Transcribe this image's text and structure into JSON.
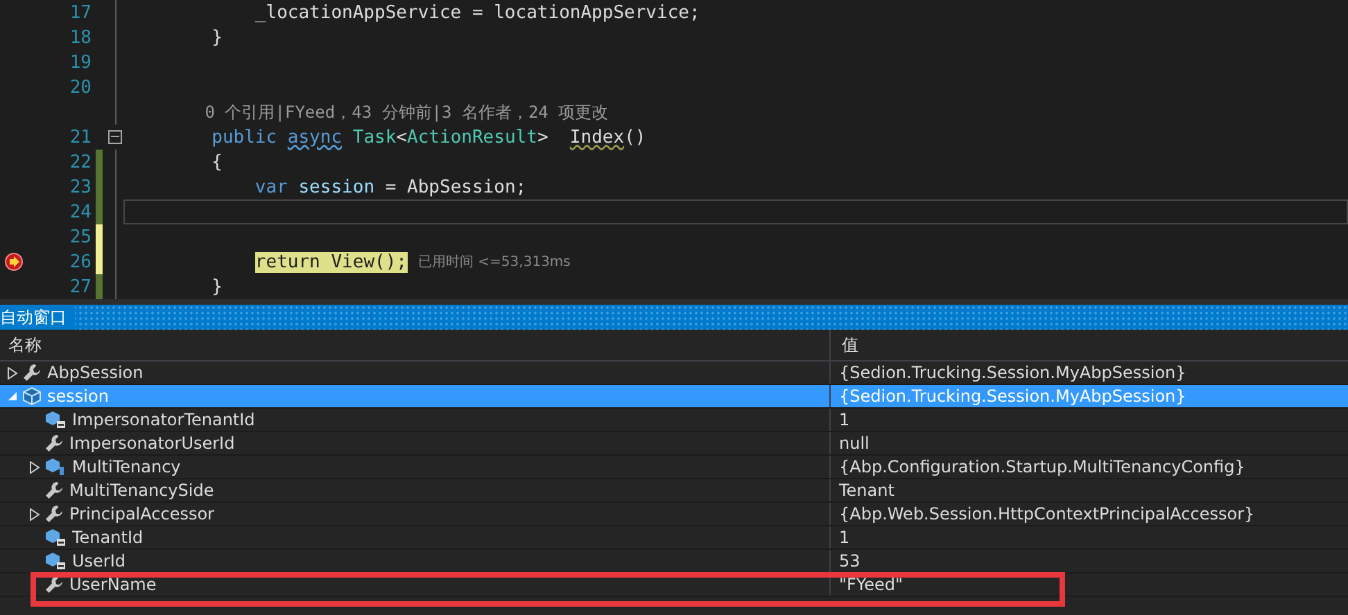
{
  "editor": {
    "lines": [
      {
        "kind": "code",
        "number": "17",
        "tokens": [
          {
            "kind": "plain",
            "text": "            _locationAppService = locationAppService;"
          }
        ]
      },
      {
        "kind": "code",
        "number": "18",
        "tokens": [
          {
            "kind": "plain",
            "text": "        }"
          }
        ]
      },
      {
        "kind": "code",
        "number": "19"
      },
      {
        "kind": "code",
        "number": "20"
      },
      {
        "kind": "codelens",
        "text": "        0 个引用|FYeed，43 分钟前|3 名作者，24 项更改"
      },
      {
        "kind": "code",
        "number": "21",
        "collapsible": true,
        "tokens": [
          {
            "kind": "keyword",
            "text": "        public "
          },
          {
            "kind": "keyword-squiggle",
            "text": "async"
          },
          {
            "kind": "type",
            "text": " Task"
          },
          {
            "kind": "plain",
            "text": "<"
          },
          {
            "kind": "type",
            "text": "ActionResult"
          },
          {
            "kind": "plain",
            "text": ">  "
          },
          {
            "kind": "method-squiggle",
            "text": "Index"
          },
          {
            "kind": "plain",
            "text": "()"
          }
        ]
      },
      {
        "kind": "code",
        "number": "22",
        "saved": true,
        "tokens": [
          {
            "kind": "plain",
            "text": "        {"
          }
        ]
      },
      {
        "kind": "code",
        "number": "23",
        "saved": true,
        "tokens": [
          {
            "kind": "keyword",
            "text": "            var"
          },
          {
            "kind": "local",
            "text": " session"
          },
          {
            "kind": "plain",
            "text": " = AbpSession;"
          }
        ]
      },
      {
        "kind": "code",
        "number": "24",
        "saved": true,
        "current": true
      },
      {
        "kind": "code",
        "number": "25",
        "saved": false
      },
      {
        "kind": "code",
        "number": "26",
        "saved": false,
        "breakpoint": true,
        "tokens": [
          {
            "kind": "statement",
            "text": "            return View();"
          }
        ],
        "tip": "已用时间 <=53,313ms"
      },
      {
        "kind": "code",
        "number": "27",
        "saved": true,
        "tokens": [
          {
            "kind": "plain",
            "text": "        }"
          }
        ]
      }
    ]
  },
  "autos": {
    "title": "自动窗口",
    "columns": [
      "名称",
      "值"
    ],
    "rows": [
      {
        "name": "AbpSession",
        "value": "{Sedion.Trucking.Session.MyAbpSession}",
        "kind": "property",
        "expandable": true,
        "expanded": false,
        "selected": false
      },
      {
        "name": "session",
        "value": "{Sedion.Trucking.Session.MyAbpSession}",
        "kind": "local",
        "expandable": true,
        "expanded": true,
        "selected": true,
        "children": [
          {
            "name": "ImpersonatorTenantId",
            "value": "1",
            "kind": "private-field",
            "selected": false
          },
          {
            "name": "ImpersonatorUserId",
            "value": "null",
            "kind": "property",
            "selected": false
          },
          {
            "name": "MultiTenancy",
            "value": "{Abp.Configuration.Startup.MultiTenancyConfig}",
            "kind": "internal-field",
            "expandable": true,
            "expanded": false,
            "selected": false
          },
          {
            "name": "MultiTenancySide",
            "value": "Tenant",
            "kind": "property",
            "selected": false
          },
          {
            "name": "PrincipalAccessor",
            "value": "{Abp.Web.Session.HttpContextPrincipalAccessor}",
            "kind": "property",
            "expandable": true,
            "expanded": false,
            "selected": false
          },
          {
            "name": "TenantId",
            "value": "1",
            "kind": "private-field",
            "selected": false
          },
          {
            "name": "UserId",
            "value": "53",
            "kind": "private-field",
            "selected": false
          },
          {
            "name": "UserName",
            "value": "\"FYeed\"",
            "kind": "property",
            "selected": false,
            "annotated": true
          }
        ]
      }
    ]
  }
}
